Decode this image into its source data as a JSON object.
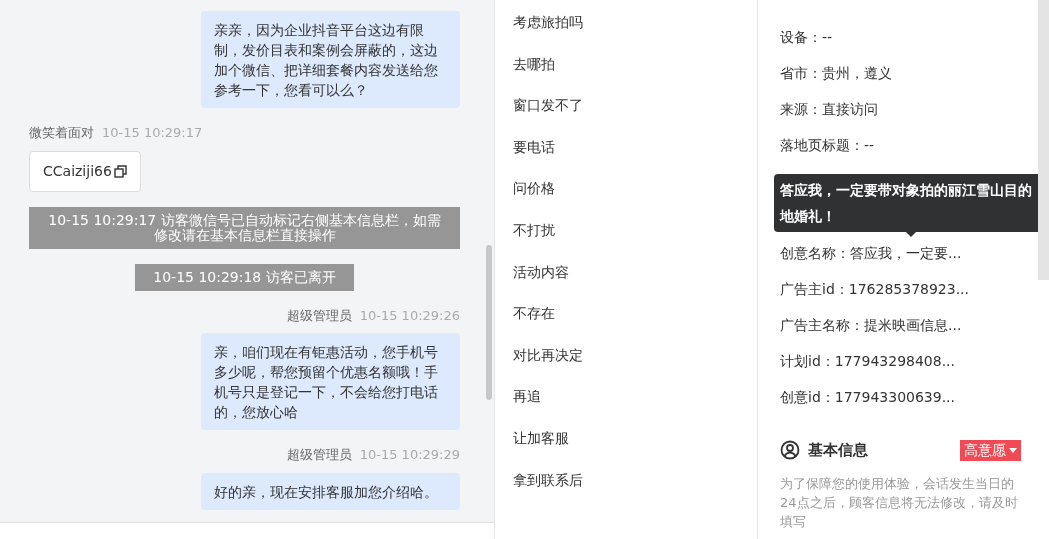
{
  "chat": {
    "messages": [
      {
        "kind": "agent",
        "text": "亲亲，因为企业抖音平台这边有限制，发价目表和案例会屏蔽的，这边加个微信、把详细套餐内容发送给您参考一下，您看可以么？"
      },
      {
        "kind": "visitor",
        "sender": "微笑着面对",
        "time": "10-15 10:29:17",
        "text": "CCaiziji66"
      },
      {
        "kind": "system",
        "text": "10-15 10:29:17 访客微信号已自动标记右侧基本信息栏，如需修改请在基本信息栏直接操作"
      },
      {
        "kind": "system",
        "text": "10-15 10:29:18 访客已离开"
      },
      {
        "kind": "agent",
        "sender": "超级管理员",
        "time": "10-15 10:29:26",
        "text": "亲，咱们现在有钜惠活动，您手机号多少呢，帮您预留个优惠名额哦！手机号只是登记一下，不会给您打电话的，您放心哈"
      },
      {
        "kind": "agent",
        "sender": "超级管理员",
        "time": "10-15 10:29:29",
        "text": "好的亲，现在安排客服加您介绍哈。"
      }
    ]
  },
  "quick_replies": [
    "考虑旅拍吗",
    "去哪拍",
    "窗口发不了",
    "要电话",
    "问价格",
    "不打扰",
    "活动内容",
    "不存在",
    "对比再决定",
    "再追",
    "让加客服",
    "拿到联系后"
  ],
  "source_info": {
    "fields": [
      "设备：--",
      "省市：贵州，遵义",
      "来源：直接访问",
      "落地页标题：--",
      "创意名称：答应我，一定要...",
      "广告主id：176285378923...",
      "广告主名称：提米映画信息...",
      "计划id：177943298408...",
      "创意id：177943300639..."
    ],
    "tooltip": "答应我，一定要带对象拍的丽江雪山目的地婚礼！"
  },
  "basic_info": {
    "title": "基本信息",
    "tag": "高意愿",
    "note": "为了保障您的使用体验，会话发生当日的24点之后，顾客信息将无法修改，请及时填写"
  }
}
